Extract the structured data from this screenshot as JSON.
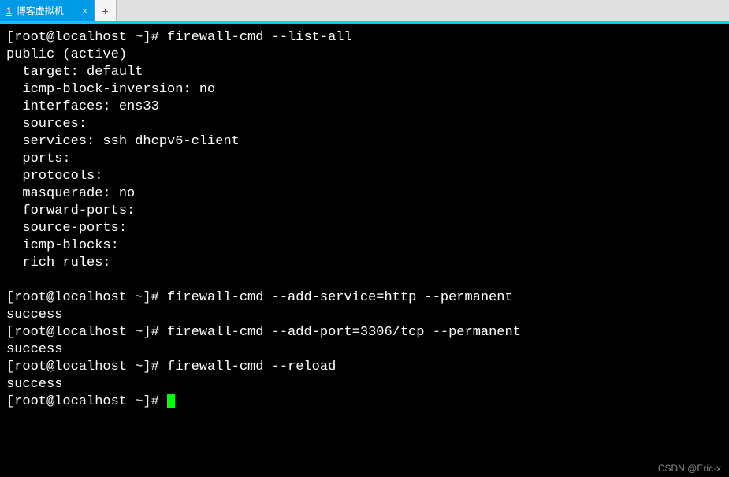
{
  "tabbar": {
    "active_tab": {
      "number": "1",
      "title": "博客虚拟机",
      "close_glyph": "×"
    },
    "newtab_glyph": "+"
  },
  "terminal": {
    "lines": [
      "[root@localhost ~]# firewall-cmd --list-all",
      "public (active)",
      "  target: default",
      "  icmp-block-inversion: no",
      "  interfaces: ens33",
      "  sources:",
      "  services: ssh dhcpv6-client",
      "  ports:",
      "  protocols:",
      "  masquerade: no",
      "  forward-ports:",
      "  source-ports:",
      "  icmp-blocks:",
      "  rich rules:",
      "",
      "[root@localhost ~]# firewall-cmd --add-service=http --permanent",
      "success",
      "[root@localhost ~]# firewall-cmd --add-port=3306/tcp --permanent",
      "success",
      "[root@localhost ~]# firewall-cmd --reload",
      "success",
      "[root@localhost ~]# "
    ]
  },
  "watermark": "CSDN @Eric·x"
}
